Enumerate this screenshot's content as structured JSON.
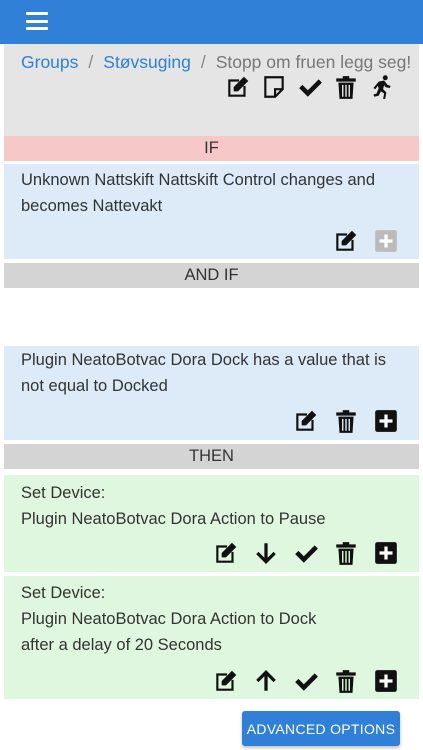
{
  "nav": {
    "menu_icon": "hamburger-menu-icon"
  },
  "breadcrumb": {
    "items": [
      "Groups",
      "Støvsuging",
      "Stopp om fruen legg seg!"
    ],
    "separator": "/"
  },
  "header_actions": [
    "edit-icon",
    "note-icon",
    "check-icon",
    "trash-icon",
    "run-icon"
  ],
  "sections": {
    "if_label": "IF",
    "andif_label": "AND IF",
    "then_label": "THEN"
  },
  "if_card": {
    "lines": [
      "Unknown Nattskift Nattskift Control changes and",
      "becomes Nattevakt"
    ],
    "actions": [
      "edit-icon",
      "plus-disabled-icon"
    ]
  },
  "andif_card": {
    "lines": [
      "Plugin NeatoBotvac Dora Dock has a value that is",
      "not equal to Docked"
    ],
    "actions": [
      "edit-icon",
      "trash-icon",
      "plus-icon"
    ]
  },
  "then_cards": [
    {
      "lines": [
        "Set Device:",
        "Plugin NeatoBotvac Dora Action to Pause"
      ],
      "actions": [
        "edit-icon",
        "arrow-down-icon",
        "check-icon",
        "trash-icon",
        "plus-icon"
      ]
    },
    {
      "lines": [
        "Set Device:",
        "Plugin NeatoBotvac Dora Action to Dock",
        "after a delay of 20 Seconds"
      ],
      "actions": [
        "edit-icon",
        "arrow-up-icon",
        "check-icon",
        "trash-icon",
        "plus-icon"
      ]
    }
  ],
  "advanced_button": "ADVANCED OPTIONS",
  "colors": {
    "primary": "#2f80d6",
    "if_band": "#f6c8c8",
    "condition_card": "#ddeaf7",
    "action_card": "#dff7df",
    "section_band": "#d4d4d4"
  }
}
